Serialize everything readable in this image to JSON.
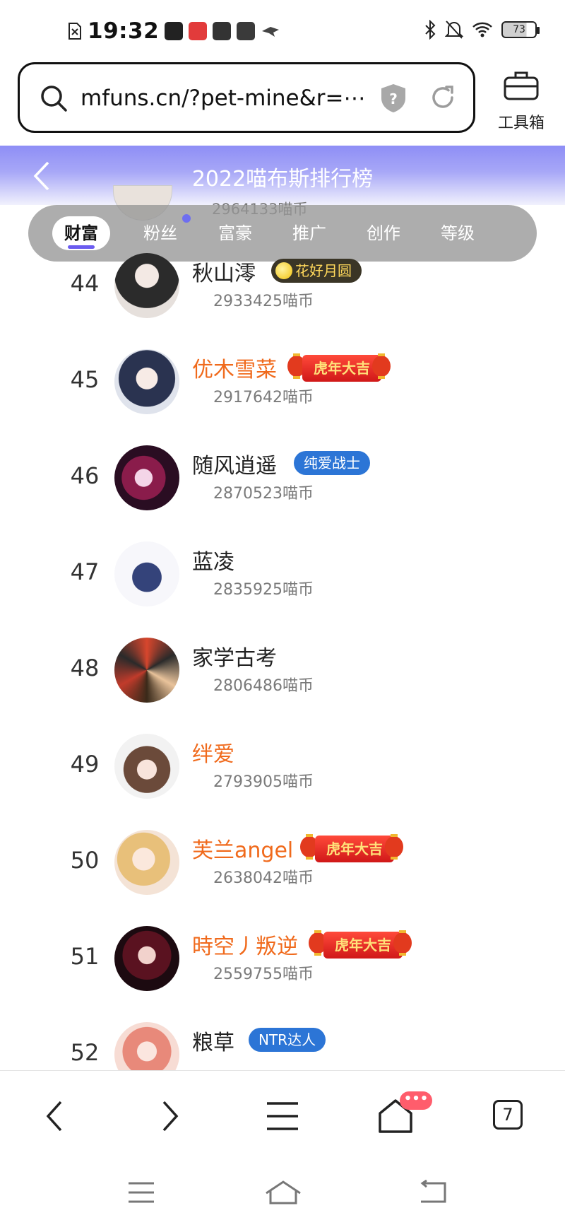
{
  "status_bar": {
    "time": "19:32",
    "battery": "73",
    "icons_left": [
      "sim-icon",
      "k-app-icon",
      "red-app-icon",
      "soul-app-icon",
      "mail-app-icon",
      "bird-app-icon"
    ],
    "icons_right": [
      "bluetooth-icon",
      "mute-icon",
      "wifi-icon",
      "battery-icon"
    ]
  },
  "browser": {
    "url": "mfuns.cn/?pet-mine&r=⋯",
    "toolbox_label": "工具箱"
  },
  "header": {
    "title": "2022喵布斯排行榜"
  },
  "tabs": [
    {
      "label": "财富",
      "active": true
    },
    {
      "label": "粉丝",
      "active": false
    },
    {
      "label": "富豪",
      "active": false
    },
    {
      "label": "推广",
      "active": false
    },
    {
      "label": "创作",
      "active": false
    },
    {
      "label": "等级",
      "active": false
    }
  ],
  "peek_row": {
    "coins": "2964133喵币"
  },
  "ranking": [
    {
      "rank": "44",
      "name": "秋山澪",
      "coins": "2933425喵币",
      "badge": "花好月圆",
      "badge_type": "gold",
      "name_style": "normal"
    },
    {
      "rank": "45",
      "name": "优木雪菜",
      "coins": "2917642喵币",
      "badge": "虎年大吉",
      "badge_type": "red",
      "name_style": "orange"
    },
    {
      "rank": "46",
      "name": "随风逍遥",
      "coins": "2870523喵币",
      "badge": "纯爱战士",
      "badge_type": "blue",
      "name_style": "normal"
    },
    {
      "rank": "47",
      "name": "蓝凌",
      "coins": "2835925喵币",
      "badge": "",
      "badge_type": "none",
      "name_style": "normal"
    },
    {
      "rank": "48",
      "name": "家学古考",
      "coins": "2806486喵币",
      "badge": "",
      "badge_type": "none",
      "name_style": "normal"
    },
    {
      "rank": "49",
      "name": "绊爱",
      "coins": "2793905喵币",
      "badge": "",
      "badge_type": "none",
      "name_style": "orange"
    },
    {
      "rank": "50",
      "name": "芙兰angel",
      "coins": "2638042喵币",
      "badge": "虎年大吉",
      "badge_type": "red",
      "name_style": "orange"
    },
    {
      "rank": "51",
      "name": "時空丿叛逆",
      "coins": "2559755喵币",
      "badge": "虎年大吉",
      "badge_type": "red",
      "name_style": "orange"
    },
    {
      "rank": "52",
      "name": "粮草",
      "coins": "",
      "badge": "NTR达人",
      "badge_type": "blue",
      "name_style": "normal"
    }
  ],
  "bottom_nav": {
    "notification": "•••",
    "tab_count": "7"
  },
  "colors": {
    "accent": "#6b5cf0",
    "orange_name": "#f06a1c",
    "blue_badge": "#2c75d6",
    "red_badge": "#d01818"
  }
}
